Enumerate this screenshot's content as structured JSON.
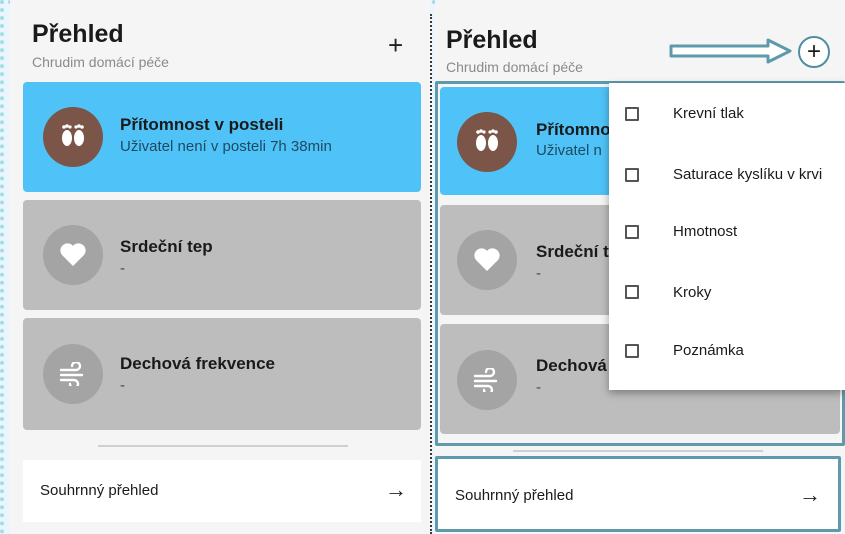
{
  "colors": {
    "accent_blue": "#4fc3f7",
    "brown": "#7b5548",
    "highlight": "#5e9aab"
  },
  "left": {
    "title": "Přehled",
    "subtitle": "Chrudim domácí péče",
    "add_symbol": "+",
    "cards": [
      {
        "title": "Přítomnost v posteli",
        "subtitle": "Uživatel není v posteli 7h 38min",
        "icon": "feet-icon"
      },
      {
        "title": "Srdeční tep",
        "subtitle": "-",
        "icon": "heart-icon"
      },
      {
        "title": "Dechová frekvence",
        "subtitle": "-",
        "icon": "wind-icon"
      }
    ],
    "summary": {
      "label": "Souhrnný přehled",
      "arrow": "→"
    }
  },
  "right": {
    "title": "Přehled",
    "subtitle": "Chrudim domácí péče",
    "add_symbol": "+",
    "cards": [
      {
        "title": "Přítomno",
        "subtitle": "Uživatel n"
      },
      {
        "title": "Srdeční t",
        "subtitle": "-"
      },
      {
        "title": "Dechová",
        "subtitle": "-"
      }
    ],
    "summary": {
      "label": "Souhrnný přehled",
      "arrow": "→"
    },
    "menu": [
      {
        "label": "Krevní tlak",
        "checked": false
      },
      {
        "label": "Saturace kyslíku v krvi",
        "checked": false
      },
      {
        "label": "Hmotnost",
        "checked": false
      },
      {
        "label": "Kroky",
        "checked": false
      },
      {
        "label": "Poznámka",
        "checked": false
      }
    ]
  }
}
